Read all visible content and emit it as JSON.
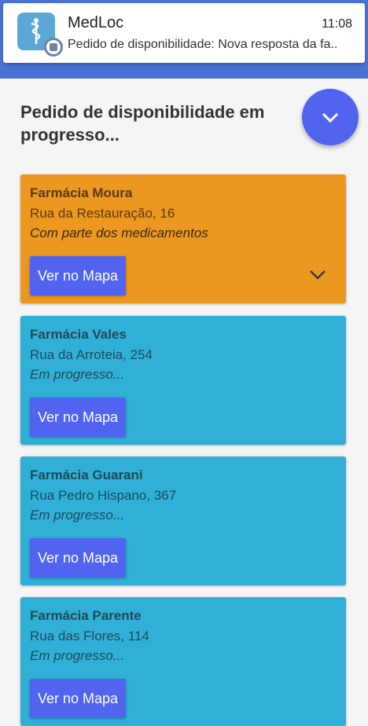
{
  "notification": {
    "app_name": "MedLoc",
    "time": "11:08",
    "text": "Pedido de disponibilidade: Nova resposta da fa.."
  },
  "page": {
    "heading": "Pedido de disponibilidade em progresso..."
  },
  "colors": {
    "header_blue": "#4a72d6",
    "fab": "#5064f0",
    "card_orange": "#ec971f",
    "card_blue": "#30b0d6",
    "button": "#5064f0"
  },
  "cards": [
    {
      "name": "Farmácia Moura",
      "address": "Rua da Restauração, 16",
      "status": "Com parte dos medicamentos",
      "button": "Ver no Mapa",
      "color": "#ec971f"
    },
    {
      "name": "Farmácia Vales",
      "address": "Rua da Arroteia, 254",
      "status": "Em progresso...",
      "button": "Ver no Mapa",
      "color": "#30b0d6"
    },
    {
      "name": "Farmácia Guarani",
      "address": "Rua Pedro Hispano, 367",
      "status": "Em progresso...",
      "button": "Ver no Mapa",
      "color": "#30b0d6"
    },
    {
      "name": "Farmácia Parente",
      "address": "Rua das Flores, 114",
      "status": "Em progresso...",
      "button": "Ver no Mapa",
      "color": "#30b0d6"
    }
  ],
  "icons": {
    "app": "caduceus-icon",
    "fab": "chevron-down-icon",
    "card_expand": "chevron-down-icon"
  }
}
